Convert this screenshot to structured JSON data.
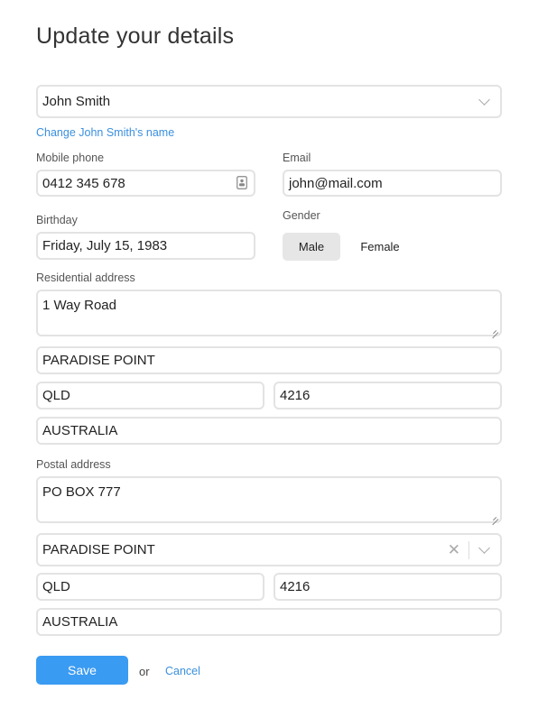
{
  "page": {
    "title": "Update your details"
  },
  "person": {
    "selected": "John Smith",
    "change_link": "Change John Smith's name"
  },
  "contact": {
    "phone_label": "Mobile phone",
    "phone_value": "0412 345 678",
    "email_label": "Email",
    "email_value": "john@mail.com"
  },
  "birthday": {
    "label": "Birthday",
    "value": "Friday, July 15, 1983"
  },
  "gender": {
    "label": "Gender",
    "options": [
      "Male",
      "Female"
    ],
    "selected": "Male"
  },
  "residential": {
    "label": "Residential address",
    "street": "1 Way Road",
    "suburb": "PARADISE POINT",
    "state": "QLD",
    "postcode": "4216",
    "country": "AUSTRALIA"
  },
  "postal": {
    "label": "Postal address",
    "street": "PO BOX 777",
    "suburb": "PARADISE POINT",
    "state": "QLD",
    "postcode": "4216",
    "country": "AUSTRALIA"
  },
  "actions": {
    "save": "Save",
    "or": "or",
    "cancel": "Cancel"
  },
  "colors": {
    "accent": "#3a9bf2",
    "link": "#3a8fde",
    "border": "#e3e3e3",
    "selected_bg": "#e6e6e6"
  }
}
